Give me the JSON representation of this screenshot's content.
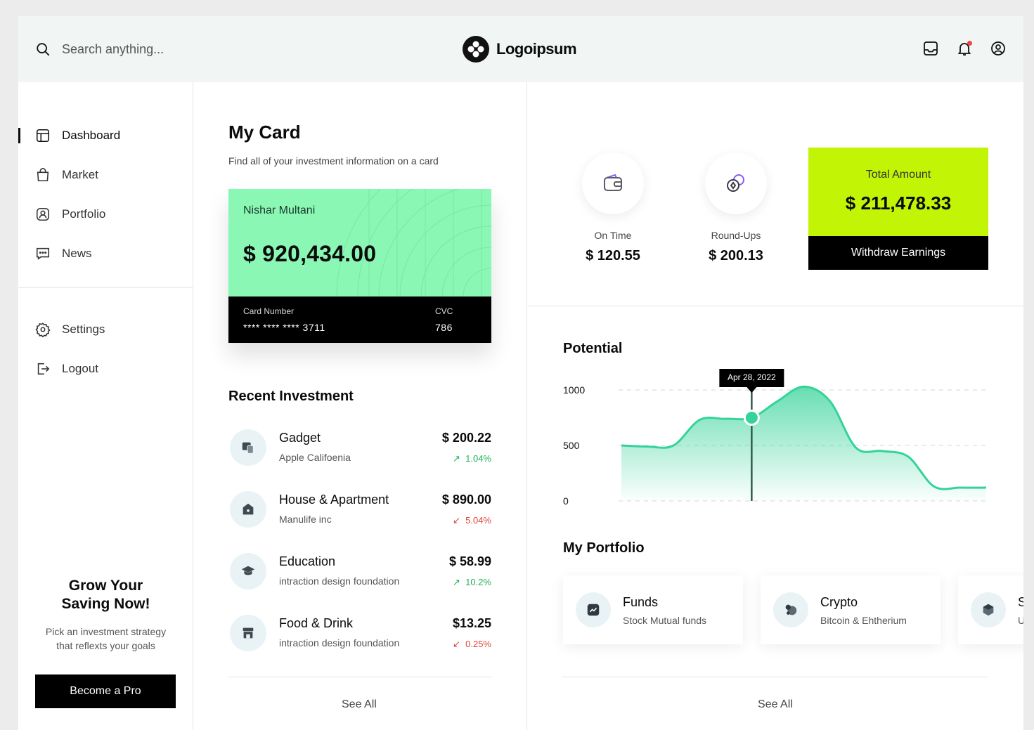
{
  "header": {
    "search_placeholder": "Search anything...",
    "logo_text": "Logoipsum",
    "notification_color": "#ef4444"
  },
  "sidebar": {
    "items": [
      {
        "label": "Dashboard",
        "icon": "layout-icon",
        "active": true
      },
      {
        "label": "Market",
        "icon": "shopping-bag-icon",
        "active": false
      },
      {
        "label": "Portfolio",
        "icon": "user-square-icon",
        "active": false
      },
      {
        "label": "News",
        "icon": "message-icon",
        "active": false
      }
    ],
    "secondary": [
      {
        "label": "Settings",
        "icon": "gear-icon"
      },
      {
        "label": "Logout",
        "icon": "logout-icon"
      }
    ],
    "promo": {
      "title": "Grow Your Saving Now!",
      "description": "Pick an investment strategy that reflexts your goals",
      "button": "Become a Pro"
    }
  },
  "my_card": {
    "title": "My Card",
    "subtitle": "Find all of your investment information on a card",
    "holder": "Nishar Multani",
    "balance": "$ 920,434.00",
    "card_number_label": "Card Number",
    "card_number": "**** **** **** 3711",
    "cvc_label": "CVC",
    "cvc": "786",
    "card_color": "#8bf7b4"
  },
  "recent_investment": {
    "title": "Recent Investment",
    "items": [
      {
        "name": "Gadget",
        "sub": "Apple Califoenia",
        "amount": "$ 200.22",
        "change": "1.04%",
        "direction": "up"
      },
      {
        "name": "House & Apartment",
        "sub": "Manulife inc",
        "amount": "$ 890.00",
        "change": "5.04%",
        "direction": "down"
      },
      {
        "name": "Education",
        "sub": "intraction design foundation",
        "amount": "$ 58.99",
        "change": "10.2%",
        "direction": "up"
      },
      {
        "name": "Food & Drink",
        "sub": "intraction design foundation",
        "amount": "$13.25",
        "change": "0.25%",
        "direction": "down"
      }
    ],
    "see_all": "See All"
  },
  "stats": {
    "on_time": {
      "label": "On Time",
      "value": "$ 120.55"
    },
    "round_ups": {
      "label": "Round-Ups",
      "value": "$ 200.13"
    },
    "total": {
      "label": "Total Amount",
      "value": "$ 211,478.33",
      "button": "Withdraw Earnings",
      "color": "#c2f505"
    }
  },
  "potential": {
    "title": "Potential"
  },
  "chart_data": {
    "type": "area",
    "x": [
      0,
      1,
      2,
      3,
      4,
      5,
      6,
      7,
      8,
      9,
      10,
      11,
      12,
      13,
      14
    ],
    "values": [
      500,
      490,
      500,
      730,
      740,
      750,
      900,
      1030,
      900,
      480,
      450,
      400,
      130,
      120,
      120
    ],
    "ylim": [
      0,
      1000
    ],
    "yticks": [
      "1000",
      "500",
      "0"
    ],
    "tooltip": {
      "label": "Apr 28, 2022",
      "index": 5
    },
    "line_color": "#34d399",
    "grid": true
  },
  "portfolio": {
    "title": "My Portfolio",
    "items": [
      {
        "name": "Funds",
        "sub": "Stock Mutual funds",
        "icon": "chart-up-icon"
      },
      {
        "name": "Crypto",
        "sub": "Bitcoin & Ehtherium",
        "icon": "crypto-icon"
      },
      {
        "name": "S",
        "sub": "U",
        "icon": "cube-icon"
      }
    ],
    "see_all": "See All"
  }
}
